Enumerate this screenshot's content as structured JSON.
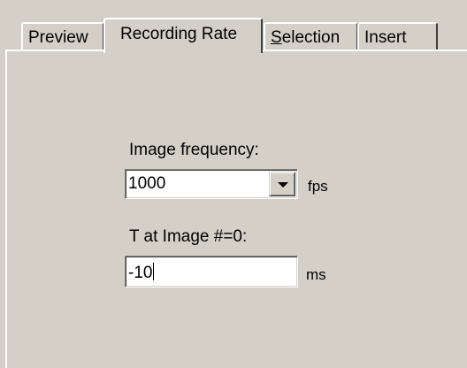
{
  "tabs": [
    {
      "label": "Preview",
      "active": false
    },
    {
      "label": "Recording Rate",
      "active": true
    },
    {
      "label_underlined": "S",
      "label_rest": "election",
      "active": false
    },
    {
      "label": "Insert",
      "active": false
    }
  ],
  "image_frequency": {
    "label": "Image frequency:",
    "value": "1000",
    "unit": "fps"
  },
  "t_at_image": {
    "label": "T at Image #=0:",
    "value": "-10",
    "unit": "ms"
  }
}
